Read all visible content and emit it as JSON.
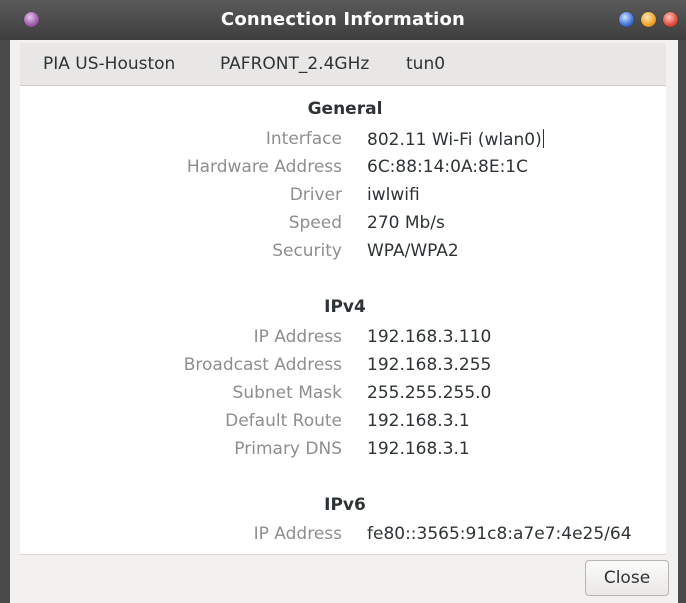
{
  "window": {
    "title": "Connection Information"
  },
  "tabs": [
    {
      "label": "PIA US-Houston"
    },
    {
      "label": "PAFRONT_2.4GHz",
      "selected": true
    },
    {
      "label": "tun0"
    }
  ],
  "general": {
    "heading": "General",
    "rows": [
      {
        "label": "Interface",
        "value": "802.11 Wi-Fi (wlan0)"
      },
      {
        "label": "Hardware Address",
        "value": "6C:88:14:0A:8E:1C"
      },
      {
        "label": "Driver",
        "value": "iwlwifi"
      },
      {
        "label": "Speed",
        "value": "270 Mb/s"
      },
      {
        "label": "Security",
        "value": "WPA/WPA2"
      }
    ]
  },
  "ipv4": {
    "heading": "IPv4",
    "rows": [
      {
        "label": "IP Address",
        "value": "192.168.3.110"
      },
      {
        "label": "Broadcast Address",
        "value": "192.168.3.255"
      },
      {
        "label": "Subnet Mask",
        "value": "255.255.255.0"
      },
      {
        "label": "Default Route",
        "value": "192.168.3.1"
      },
      {
        "label": "Primary DNS",
        "value": "192.168.3.1"
      }
    ]
  },
  "ipv6": {
    "heading": "IPv6",
    "rows": [
      {
        "label": "IP Address",
        "value": "fe80::3565:91c8:a7e7:4e25/64"
      }
    ]
  },
  "footer": {
    "close_label": "Close"
  },
  "colors": {
    "tab_accent": "#4a90d9",
    "label_text": "#8e8e8e",
    "value_text": "#2e3436"
  }
}
